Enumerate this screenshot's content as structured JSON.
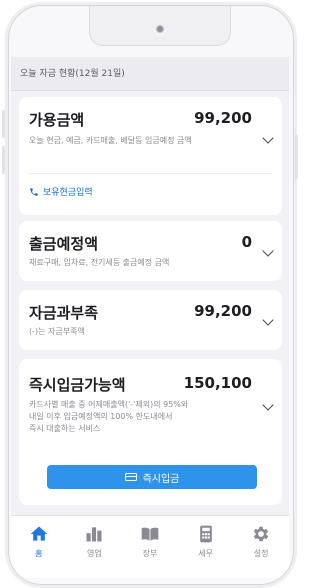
{
  "header": {
    "date_text": "오늘 자금 현황(12월 21일)"
  },
  "cards": {
    "available": {
      "title": "가용금액",
      "amount": "99,200",
      "description": "오늘 현금, 예금, 카드매출, 배달등 입금예정 금액",
      "link_label": "보유현금입력"
    },
    "outgoing": {
      "title": "출금예정액",
      "amount": "0",
      "description": "재료구매, 임차료, 전기세등 출금예정 금액"
    },
    "surplus": {
      "title": "자금과부족",
      "amount": "99,200",
      "description": "(-)는 자금부족액"
    },
    "instant": {
      "title": "즉시입금가능액",
      "amount": "150,100",
      "description_lines": [
        "카드사별 매출 중 어제매출액('-'제외)의 95%와",
        "내일 이후 입금예정액의 100% 한도내에서",
        "즉시 대출하는 서비스"
      ],
      "button_label": "즉시입금"
    }
  },
  "tabbar": {
    "items": [
      {
        "label": "홈",
        "icon": "home-icon",
        "active": true
      },
      {
        "label": "영업",
        "icon": "bar-chart-icon",
        "active": false
      },
      {
        "label": "장부",
        "icon": "book-icon",
        "active": false
      },
      {
        "label": "세무",
        "icon": "calculator-icon",
        "active": false
      },
      {
        "label": "설정",
        "icon": "gear-icon",
        "active": false
      }
    ]
  },
  "colors": {
    "accent": "#2f93ec",
    "active_tab": "#1d7ae0",
    "link": "#1a6fd6"
  }
}
